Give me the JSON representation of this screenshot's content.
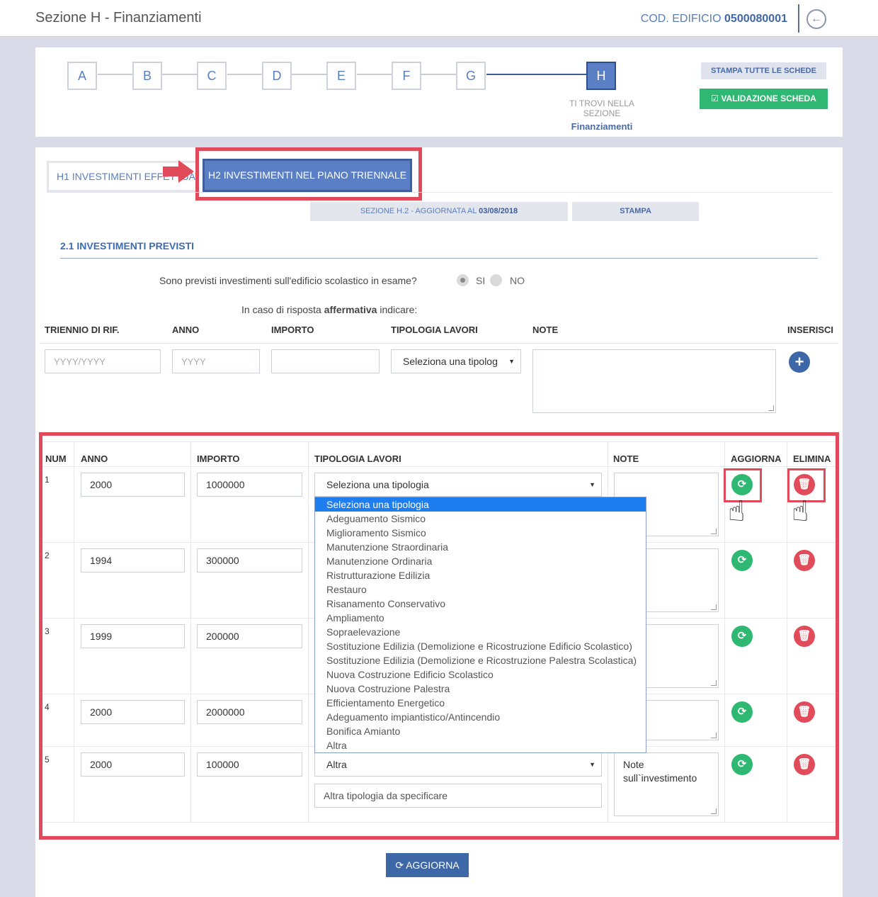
{
  "header": {
    "title": "Sezione H - Finanziamenti",
    "code_label": "COD. EDIFICIO",
    "code_value": "0500080001",
    "back_icon": "arrow-left-circle-icon"
  },
  "steps": {
    "items": [
      "A",
      "B",
      "C",
      "D",
      "E",
      "F",
      "G",
      "H"
    ],
    "current": "H",
    "caption": "TI TROVI NELLA SEZIONE",
    "caption_section": "Finanziamenti",
    "print_all_label": "STAMPA TUTTE LE SCHEDE",
    "validate_label": "VALIDAZIONE SCHEDA"
  },
  "tabs": {
    "h1_label": "H1 INVESTIMENTI EFFETTUATI",
    "h2_label": "H2 INVESTIMENTI NEL PIANO TRIENNALE"
  },
  "section_info": {
    "prefix": "SEZIONE H.2 - AGGIORNATA AL",
    "date": "03/08/2018",
    "print_label": "STAMPA"
  },
  "investments": {
    "heading": "2.1 INVESTIMENTI PREVISTI",
    "question": "Sono previsti investimenti sull'edificio scolastico in esame?",
    "yes_label": "SI",
    "no_label": "NO",
    "selected": "SI",
    "hint_pre": "In caso di risposta",
    "hint_bold": "affermativa",
    "hint_post": "indicare:"
  },
  "form": {
    "headers": [
      "TRIENNIO DI RIF.",
      "ANNO",
      "IMPORTO",
      "TIPOLOGIA LAVORI",
      "NOTE",
      "INSERISCI"
    ],
    "triennio_placeholder": "YYYY/YYYY",
    "anno_placeholder": "YYYY",
    "importo_value": "",
    "tipologia_selected": "Seleziona una tipolog",
    "note_value": ""
  },
  "table": {
    "headers": [
      "NUM",
      "ANNO",
      "IMPORTO",
      "TIPOLOGIA LAVORI",
      "NOTE",
      "AGGIORNA",
      "ELIMINA"
    ],
    "rows": [
      {
        "num": "1",
        "anno": "2000",
        "importo": "1000000",
        "tipologia": "Seleziona una tipologia",
        "note": ""
      },
      {
        "num": "2",
        "anno": "1994",
        "importo": "300000",
        "tipologia": "",
        "note": ""
      },
      {
        "num": "3",
        "anno": "1999",
        "importo": "200000",
        "tipologia": "",
        "note": ""
      },
      {
        "num": "4",
        "anno": "2000",
        "importo": "2000000",
        "tipologia": "",
        "note": ""
      },
      {
        "num": "5",
        "anno": "2000",
        "importo": "100000",
        "tipologia": "Altra",
        "altra_placeholder": "Altra tipologia da specificare",
        "note": "Note sull`investimento"
      }
    ]
  },
  "dropdown_options": [
    "Seleziona una tipologia",
    "Adeguamento Sismico",
    "Miglioramento Sismico",
    "Manutenzione Straordinaria",
    "Manutenzione Ordinaria",
    "Ristrutturazione Edilizia",
    "Restauro",
    "Risanamento Conservativo",
    "Ampliamento",
    "Sopraelevazione",
    "Sostituzione Edilizia (Demolizione e Ricostruzione Edificio Scolastico)",
    "Sostituzione Edilizia (Demolizione e Ricostruzione Palestra Scolastica)",
    "Nuova Costruzione Edificio Scolastico",
    "Nuova Costruzione Palestra",
    "Efficientamento Energetico",
    "Adeguamento impiantistico/Antincendio",
    "Bonifica Amianto",
    "Altra"
  ],
  "footer": {
    "aggiorna_label": "AGGIORNA"
  },
  "colors": {
    "accent": "#5b7fc4",
    "green": "#2eb872",
    "red": "#e24b59",
    "highlight": "#e04a5a"
  }
}
